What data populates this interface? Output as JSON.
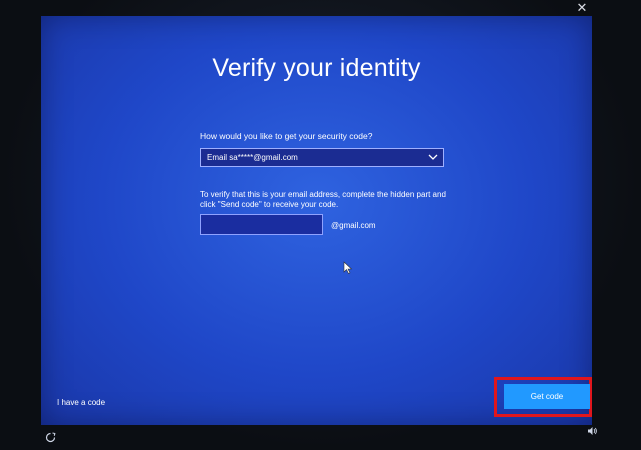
{
  "window": {
    "close_label": "✕"
  },
  "dialog": {
    "title": "Verify your identity",
    "question": "How would you like to get your security code?",
    "method_select": {
      "selected": "Email sa*****@gmail.com"
    },
    "verify_text": "To verify that this is your email address, complete the hidden part and click \"Send code\" to receive your code.",
    "email_input": {
      "value": "",
      "suffix": "@gmail.com"
    }
  },
  "footer": {
    "have_code_label": "I have a code",
    "get_code_label": "Get code"
  },
  "icons": {
    "close": "close-icon",
    "chevron": "chevron-down-icon",
    "cursor": "mouse-pointer-icon",
    "ease_of_access": "ease-of-access-icon",
    "volume": "volume-icon"
  },
  "colors": {
    "background": "#1f47c8",
    "button": "#2199ff",
    "highlight": "#e0161d",
    "text": "#ffffff"
  }
}
